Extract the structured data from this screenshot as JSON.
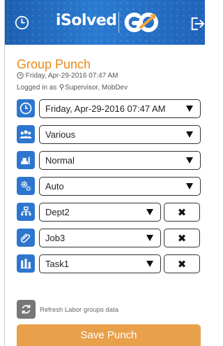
{
  "header": {
    "brand_text": "iSolved",
    "logo_text": "GO",
    "left_icon": "clock-icon",
    "right_icon": "logout-icon",
    "colors": {
      "bar": "#2a7bd1",
      "accent": "#e88a1a"
    }
  },
  "page": {
    "title": "Group Punch",
    "datetime": "Friday, Apr-29-2016 07:47 AM",
    "logged_in": "Logged in as ",
    "user": "Supervisor, MobDev"
  },
  "fields": {
    "datetime": {
      "value": "Friday, Apr-29-2016 07:47 AM",
      "icon": "clock-icon"
    },
    "employees": {
      "value": "Various",
      "icon": "group-icon"
    },
    "punch_type": {
      "value": "Normal",
      "icon": "stamp-icon"
    },
    "mode": {
      "value": "Auto",
      "icon": "gears-icon"
    },
    "labor1": {
      "value": "Dept2",
      "icon": "org-chart-icon",
      "clear": "✖"
    },
    "labor2": {
      "value": "Job3",
      "icon": "paperclip-icon",
      "clear": "✖"
    },
    "labor3": {
      "value": "Task1",
      "icon": "bars-icon",
      "clear": "✖"
    }
  },
  "footer": {
    "refresh_label": "Refresh Labor groups data",
    "save_label": "Save Punch"
  }
}
